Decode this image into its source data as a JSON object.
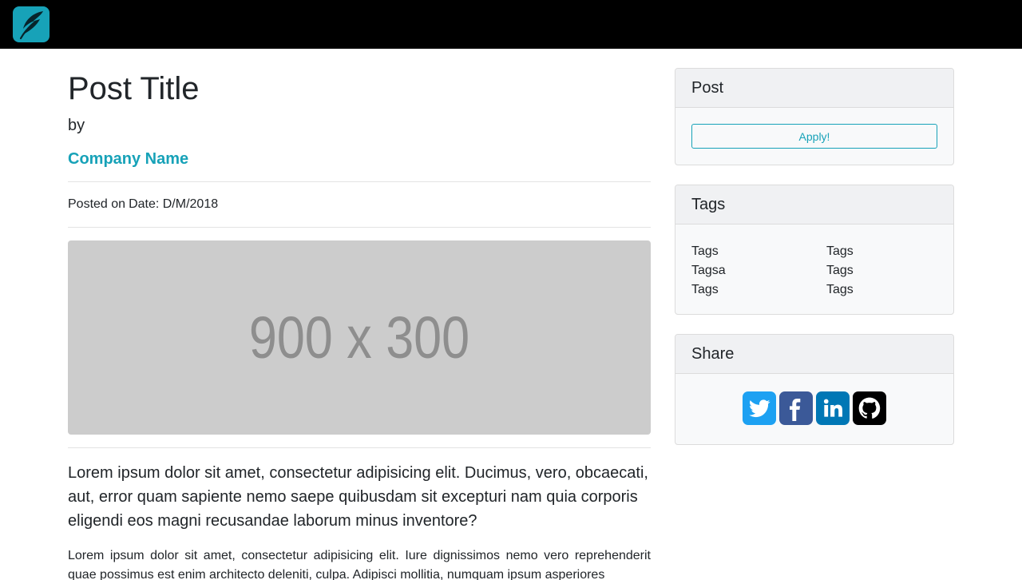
{
  "navbar": {
    "logo_icon": "quill-feather-logo"
  },
  "post": {
    "title": "Post Title",
    "by_label": "by",
    "company": "Company Name",
    "posted_label": "Posted on",
    "posted_date": "Date: D/M/2018",
    "image_placeholder": "900 x 300",
    "lead": "Lorem ipsum dolor sit amet, consectetur adipisicing elit. Ducimus, vero, obcaecati, aut, error quam sapiente nemo saepe quibusdam sit excepturi nam quia corporis eligendi eos magni recusandae laborum minus inventore?",
    "paragraph": "Lorem ipsum dolor sit amet, consectetur adipisicing elit. Iure dignissimos nemo vero reprehenderit quae possimus est enim architecto deleniti, culpa. Adipisci mollitia, numquam ipsum asperiores"
  },
  "sidebar": {
    "post_card": {
      "title": "Post",
      "apply_label": "Apply!"
    },
    "tags_card": {
      "title": "Tags",
      "tags": [
        "Tags",
        "Tags",
        "Tagsa",
        "Tags",
        "Tags",
        "Tags"
      ]
    },
    "share_card": {
      "title": "Share",
      "icons": [
        "twitter-icon",
        "facebook-icon",
        "linkedin-icon",
        "github-icon"
      ]
    }
  },
  "colors": {
    "accent": "#17a2b8",
    "twitter": "#1da1f2",
    "facebook": "#3b5998",
    "linkedin": "#0077b5",
    "github": "#000000"
  }
}
